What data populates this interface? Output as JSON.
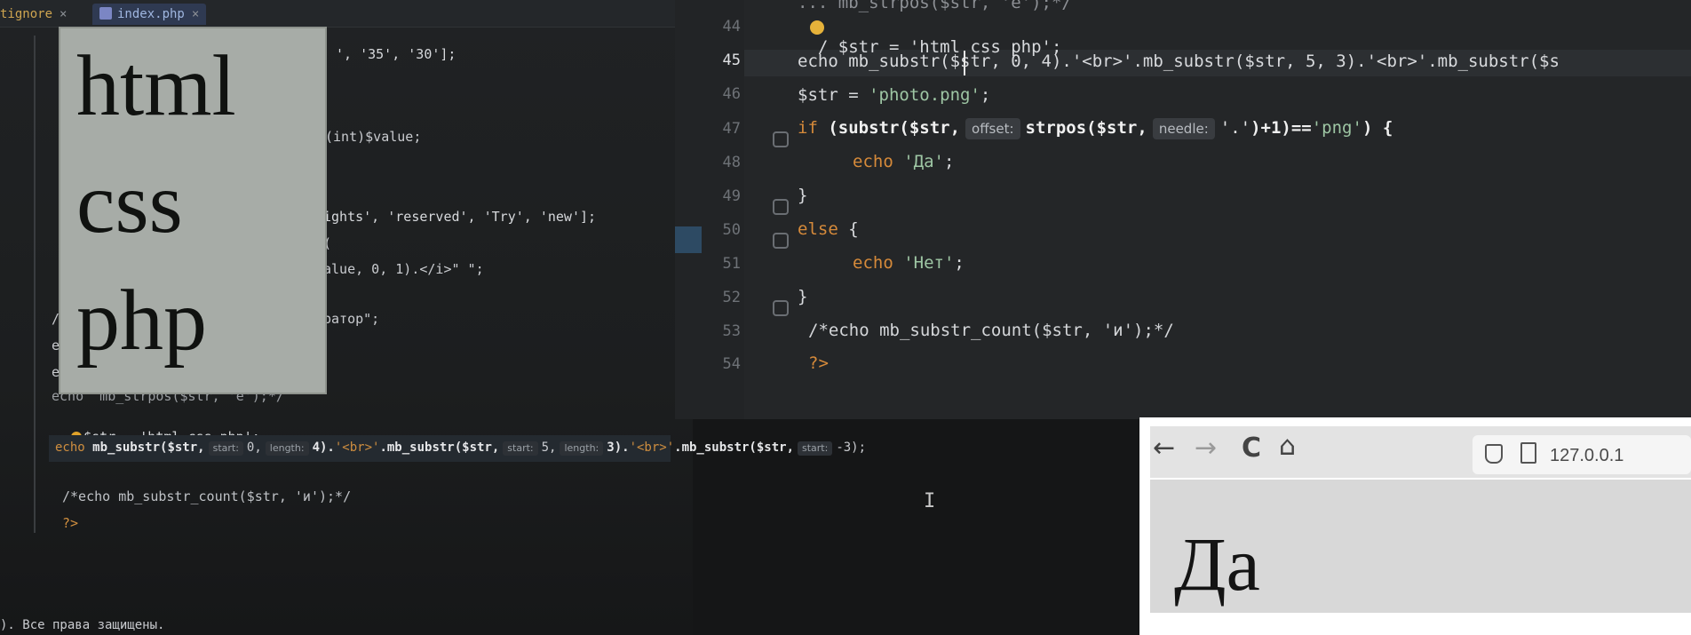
{
  "left_editor": {
    "tabs": [
      {
        "label": "tignore",
        "close": "×"
      },
      {
        "label": "index.php",
        "close": "×"
      }
    ],
    "lines": {
      "l1": "', '35', '30'];",
      "l2": "(int)$value;",
      "l3": "ights', 'reserved', 'Try', 'new'];",
      "l4": "(",
      "l5": "alue, 0, 1).</i>\" \";",
      "l6": "ратор\";",
      "l7_prefix": "echo  mb_strpos($str, 'e');*/",
      "l8": "$str = 'html css php';",
      "l9_a": "echo",
      "l9_b": "mb_substr($str,",
      "l9_h1": "start:",
      "l9_c": "0,",
      "l9_h2": "length:",
      "l9_d": "4).",
      "l9_e": "'<br>'",
      "l9_f": ".mb_substr($str,",
      "l9_h3": "start:",
      "l9_g": "5,",
      "l9_h4": "length:",
      "l9_i": "3).",
      "l9_j": "'<br>'",
      "l9_k": ".mb_substr($str,",
      "l9_h5": "start:",
      "l9_l": "-3);",
      "l10": "/*echo mb_substr_count($str, 'и');*/",
      "l11": "?>",
      "stub1": "e",
      "stub2": "e",
      "stub3": "/"
    },
    "overlay_words": [
      "html",
      "css",
      "php"
    ],
    "footer": "). Все права защищены."
  },
  "right_editor": {
    "line_numbers": [
      "44",
      "45",
      "46",
      "47",
      "48",
      "49",
      "50",
      "51",
      "52",
      "53",
      "54"
    ],
    "lines": {
      "l44": "/ $str = 'html css php';",
      "l45": "echo mb_substr($str, 0, 4).'<br>'.mb_substr($str, 5, 3).'<br>'.mb_substr($s",
      "l46_a": "$str = ",
      "l46_b": "'photo.png'",
      "l46_c": ";",
      "l47_a": "if",
      "l47_b": " (substr($str,",
      "l47_h1": "offset:",
      "l47_c": "strpos($str,",
      "l47_h2": "needle:",
      "l47_d": "'.'",
      "l47_e": ")+1)==",
      "l47_f": "'png'",
      "l47_g": ") {",
      "l48_a": "echo",
      "l48_b": " 'Да'",
      "l48_c": ";",
      "l49": "}",
      "l50_a": "else",
      "l50_b": " {",
      "l51_a": "echo",
      "l51_b": " 'Нет'",
      "l51_c": ";",
      "l52": "}",
      "l53": "/*echo mb_substr_count($str, 'и');*/",
      "l54": "?>"
    },
    "top_partial": "... mb_strpos($str, 'e');*/"
  },
  "browser": {
    "back": "←",
    "forward": "→",
    "reload": "C",
    "home": "⌂",
    "url": "127.0.0.1",
    "page_text": "Да"
  },
  "colors": {
    "accent_tab": "#2f3a52",
    "string_green": "#9ec6a4",
    "keyword_orange": "#d68a3a"
  }
}
